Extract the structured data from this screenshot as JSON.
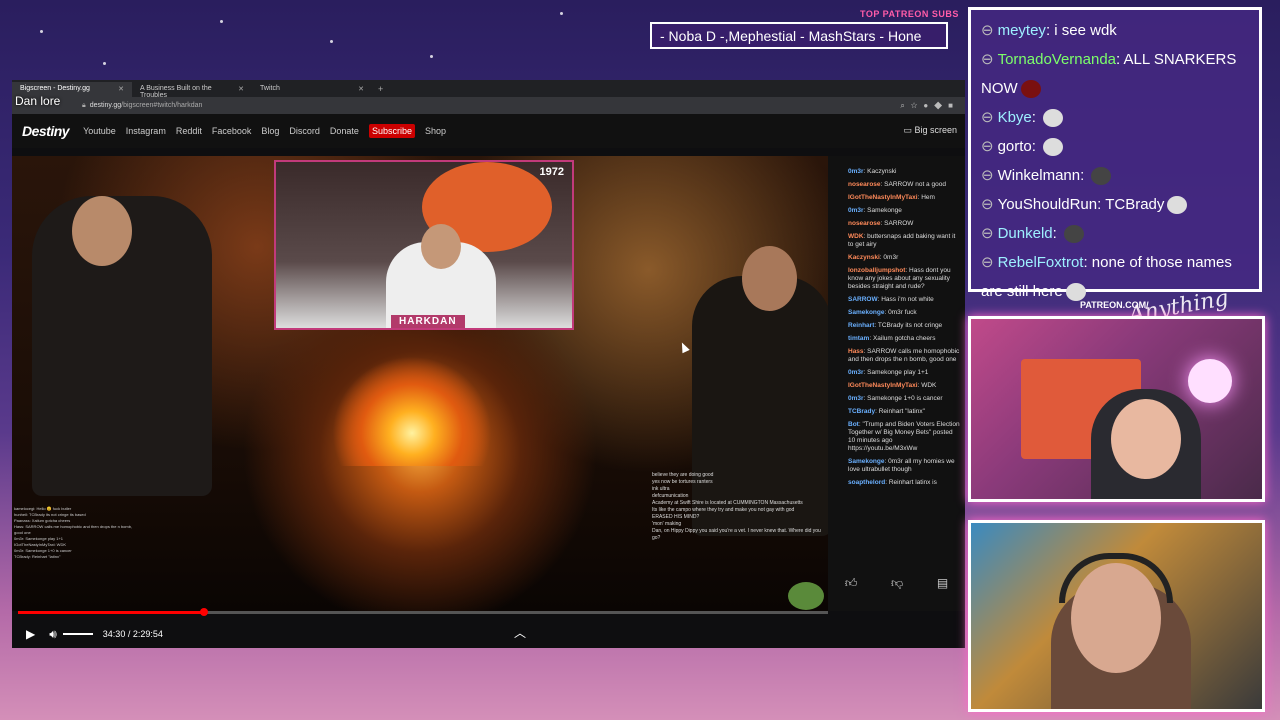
{
  "overlay": {
    "patreon_label": "TOP PATREON SUBS",
    "ticker_text": "- Noba D -,Mephestial - MashStars - Hone",
    "patreon_url": "PATREON.COM/",
    "brand_script": "Anything Goes"
  },
  "browser": {
    "tabs": [
      {
        "label": "Bigscreen - Destiny.gg",
        "active": true
      },
      {
        "label": "A Business Built on the Troubles",
        "active": false
      },
      {
        "label": "Twitch",
        "active": false
      }
    ],
    "url_host": "destiny.gg",
    "url_path": "/bigscreen#twitch/harkdan",
    "corner_label": "Dan lore"
  },
  "site": {
    "logo": "Destiny",
    "nav": [
      "Youtube",
      "Instagram",
      "Reddit",
      "Facebook",
      "Blog",
      "Discord",
      "Donate"
    ],
    "subscribe_label": "Subscribe",
    "shop_label": "Shop",
    "bigscreen_label": "Big screen"
  },
  "video": {
    "pip_year": "1972",
    "pip_name": "HARKDAN",
    "time": "34:30 / 2:29:54",
    "progress": 0.23,
    "vid_chat_left": [
      "kamelocegi: Hello 😊 fuck butler",
      "hunheil: TCBrady its not cringe its based",
      "Paanass: Xailum gotcha cheers",
      "Hass: SARROW calls me homophobic and then drops the n bomb, good one",
      "0m3r: Samekonge play 1+1",
      "IGotTheNastyInMyTaxi: WDK",
      "0m3r: Samekonge 1+0 is cancer",
      "TCBrady: Reinhart \"latinx\""
    ],
    "vid_chat_right": [
      "believe they are doing good",
      "yes now be tortures ranters",
      "ink ultra",
      "defcumunication",
      "Academy at Swift Shire is located at CUMMINGTON Massachusetts",
      "Its like the campo where they try and make you not gay with god",
      "ERASED HIS MIND?",
      "'mon' making",
      "Dan, on Hippy Dippy you said you're a vet. I never knew that. Where did you go?"
    ]
  },
  "site_chat": [
    {
      "user": "0m3r",
      "msg": "Kaczynski",
      "color": "#6ab0ff"
    },
    {
      "user": "nosearose",
      "msg": "SARROW not a good",
      "color": "#ff8a5a"
    },
    {
      "user": "IGotTheNastyInMyTaxi",
      "msg": "Hem",
      "color": "#ff8a5a"
    },
    {
      "user": "0m3r",
      "msg": "Samekonge",
      "color": "#6ab0ff"
    },
    {
      "user": "nosearose",
      "msg": "SARROW",
      "color": "#ff8a5a"
    },
    {
      "user": "WDK",
      "msg": "buttersnaps add baking want it to get airy",
      "color": "#ff8a5a"
    },
    {
      "user": "Kaczynski",
      "msg": "0m3r",
      "color": "#ff8a5a"
    },
    {
      "user": "lonzoballjumpshot",
      "msg": "Hass dont you know any jokes about any sexuality besides straight and rude?",
      "color": "#ff8a5a"
    },
    {
      "user": "SARROW",
      "msg": "Hass i'm not white",
      "color": "#6ab0ff"
    },
    {
      "user": "Samekonge",
      "msg": "0m3r fuck",
      "color": "#6ab0ff"
    },
    {
      "user": "Reinhart",
      "msg": "TCBrady its not cringe",
      "color": "#6ab0ff"
    },
    {
      "user": "timtam",
      "msg": "Xailum gotcha cheers",
      "color": "#6ab0ff"
    },
    {
      "user": "Hass",
      "msg": "SARROW calls me homophobic and then drops the n bomb, good one",
      "color": "#ff8a5a"
    },
    {
      "user": "0m3r",
      "msg": "Samekonge play 1+1",
      "color": "#6ab0ff"
    },
    {
      "user": "IGotTheNastyInMyTaxi",
      "msg": "WDK",
      "color": "#ff8a5a"
    },
    {
      "user": "0m3r",
      "msg": "Samekonge 1+0 is cancer",
      "color": "#6ab0ff"
    },
    {
      "user": "TCBrady",
      "msg": "Reinhart \"latinx\"",
      "color": "#6ab0ff"
    },
    {
      "user": "Bot",
      "msg": "\"Trump and Biden Voters Election Together w/ Big Money Bets\" posted 10 minutes ago https://youtu.be/M3xWw",
      "color": "#6ab0ff"
    },
    {
      "user": "Samekonge",
      "msg": "0m3r all my homies we love ultrabullet though",
      "color": "#6ab0ff"
    },
    {
      "user": "soapthelord",
      "msg": "Reinhart latinx is",
      "color": "#6ab0ff"
    }
  ],
  "stream_chat": [
    {
      "user": "meytey",
      "msg": "i see wdk",
      "name_color": "cyan",
      "emote": ""
    },
    {
      "user": "TornadoVernanda",
      "msg": "ALL SNARKERS NOW",
      "name_color": "green",
      "emote": "red"
    },
    {
      "user": "Kbye",
      "msg": "",
      "name_color": "cyan",
      "emote": "light"
    },
    {
      "user": "gorto",
      "msg": "",
      "name_color": "plain",
      "emote": "light"
    },
    {
      "user": "Winkelmann",
      "msg": "",
      "name_color": "plain",
      "emote": "dark"
    },
    {
      "user": "YouShouldRun",
      "msg": "TCBrady",
      "name_color": "plain",
      "emote": "light"
    },
    {
      "user": "Dunkeld",
      "msg": "",
      "name_color": "cyan",
      "emote": "dark"
    },
    {
      "user": "RebelFoxtrot",
      "msg": "none of those names are still here",
      "name_color": "cyan",
      "emote": "light"
    }
  ]
}
